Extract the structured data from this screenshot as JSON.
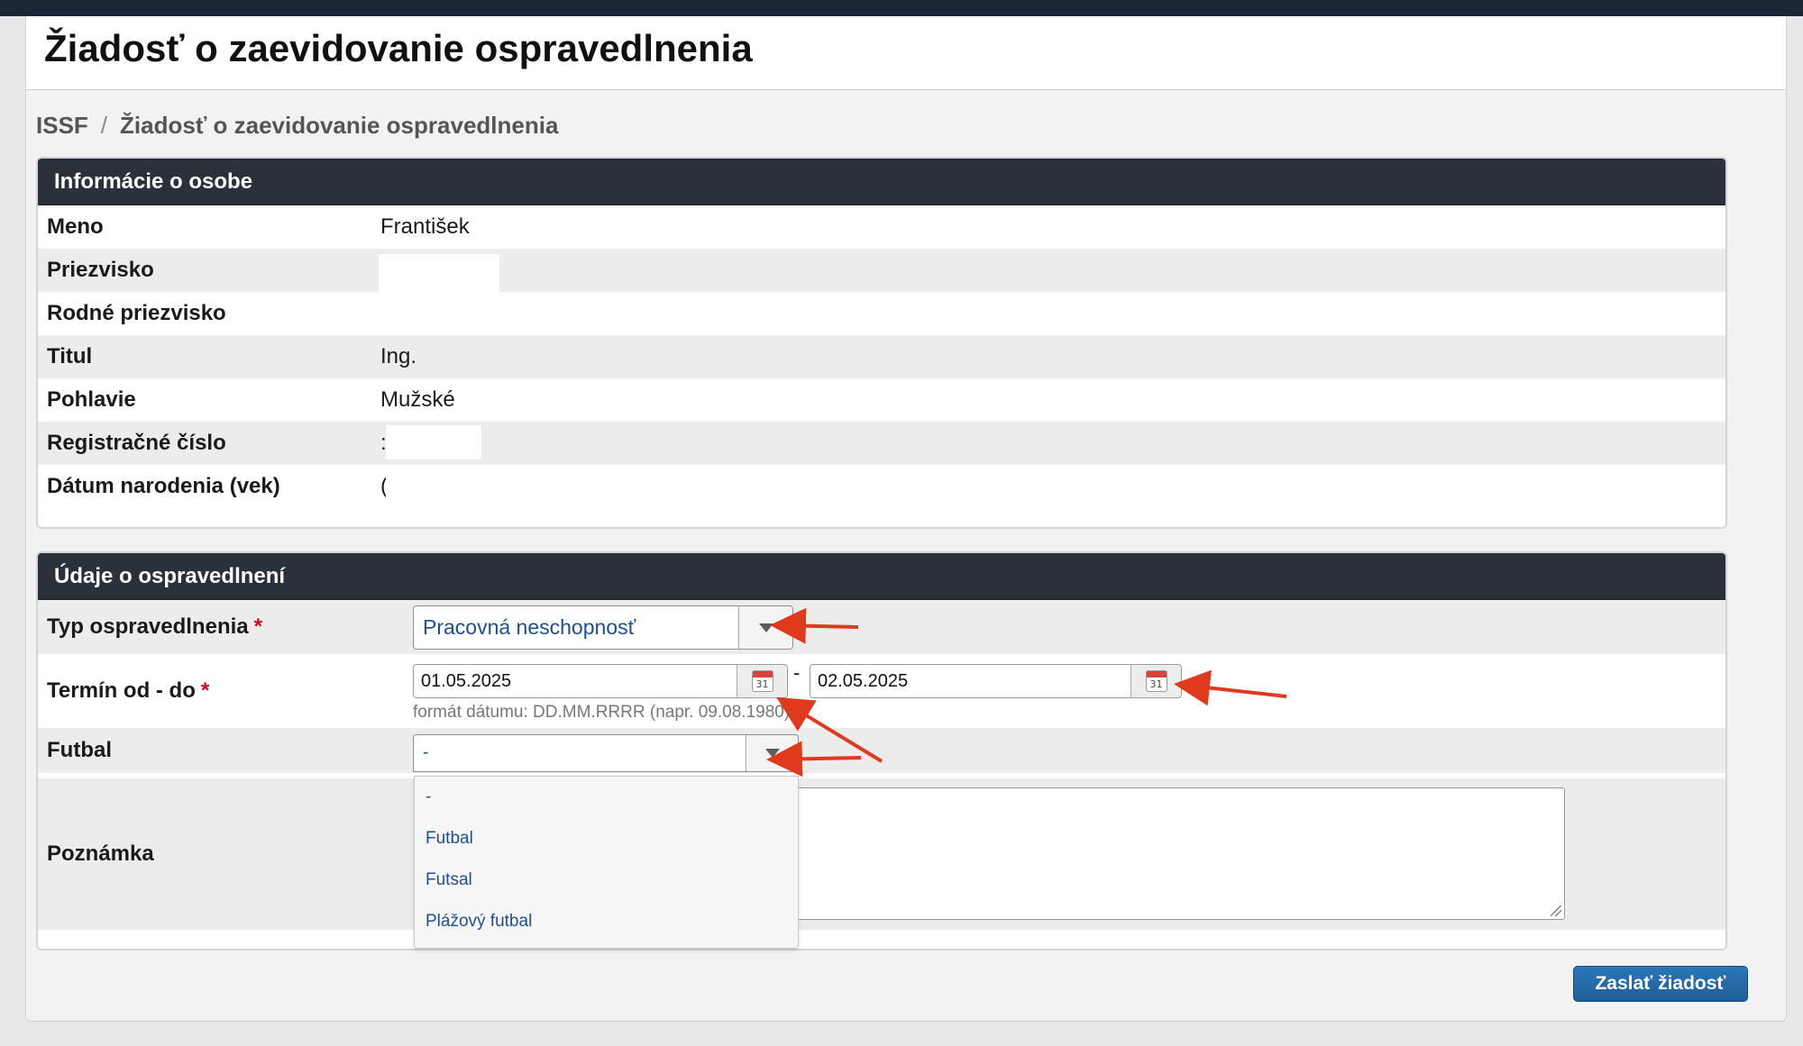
{
  "page": {
    "title": "Žiadosť o zaevidovanie ospravedlnenia"
  },
  "breadcrumb": {
    "root": "ISSF",
    "separator": "/",
    "current": "Žiadosť o zaevidovanie ospravedlnenia"
  },
  "person_panel": {
    "header": "Informácie o osobe",
    "rows": [
      {
        "label": "Meno",
        "value": "František"
      },
      {
        "label": "Priezvisko",
        "value": ""
      },
      {
        "label": "Rodné priezvisko",
        "value": ""
      },
      {
        "label": "Titul",
        "value": "Ing."
      },
      {
        "label": "Pohlavie",
        "value": "Mužské"
      },
      {
        "label": "Registračné číslo",
        "value": ":"
      },
      {
        "label": "Dátum narodenia (vek)",
        "value": "("
      }
    ]
  },
  "excuse_panel": {
    "header": "Údaje o ospravedlnení",
    "type": {
      "label": "Typ ospravedlnenia",
      "required_mark": "*",
      "selected": "Pracovná neschopnosť"
    },
    "term": {
      "label": "Termín od - do",
      "required_mark": "*",
      "from": "01.05.2025",
      "separator": "-",
      "to": "02.05.2025",
      "calendar_day": "31",
      "hint": "formát dátumu: DD.MM.RRRR (napr. 09.08.1980)"
    },
    "sport": {
      "label": "Futbal",
      "selected": "-",
      "options": [
        "-",
        "Futbal",
        "Futsal",
        "Plážový futbal"
      ]
    },
    "note": {
      "label": "Poznámka",
      "value": ""
    }
  },
  "actions": {
    "submit_label": "Zaslať žiadosť"
  },
  "colors": {
    "header_bar": "#2b313b",
    "required": "#d0021b",
    "link_text": "#1f4f8c",
    "submit_button": "#1f5f97",
    "annotation_arrow": "#e03a1e"
  }
}
